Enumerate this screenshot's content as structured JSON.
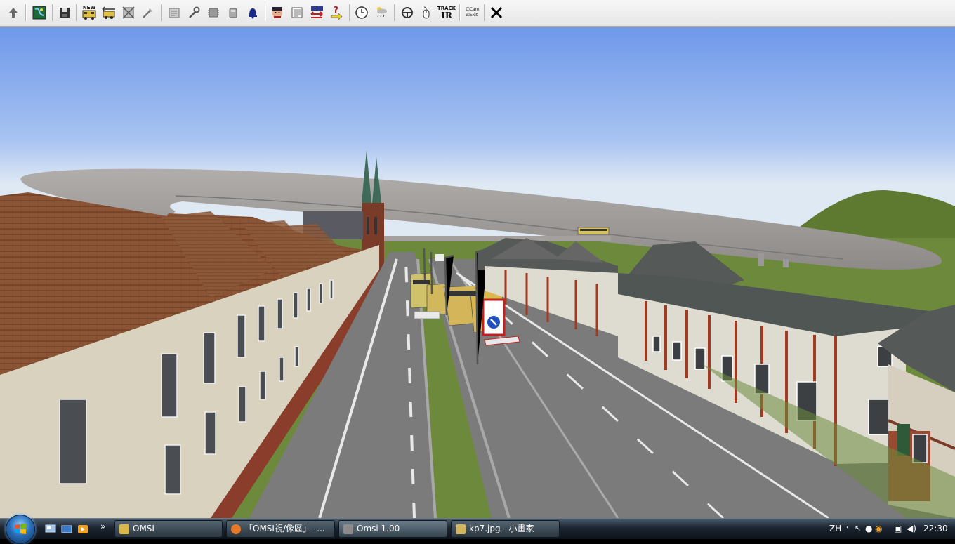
{
  "toolbar": {
    "items": [
      {
        "name": "up-arrow-icon"
      },
      {
        "name": "map-icon"
      },
      {
        "name": "save-icon"
      },
      {
        "name": "new-bus-icon",
        "label": "NEW"
      },
      {
        "name": "bus-select-icon"
      },
      {
        "name": "bus-remove-icon"
      },
      {
        "name": "bus-tools-icon"
      },
      {
        "name": "timetable-icon"
      },
      {
        "name": "wrench-icon"
      },
      {
        "name": "chip-icon"
      },
      {
        "name": "fuel-icon"
      },
      {
        "name": "bell-icon"
      },
      {
        "name": "driver-icon"
      },
      {
        "name": "ticket-icon"
      },
      {
        "name": "transfer-icon"
      },
      {
        "name": "help-arrow-icon"
      },
      {
        "name": "clock-icon"
      },
      {
        "name": "weather-icon"
      },
      {
        "name": "steering-icon"
      },
      {
        "name": "mouse-icon"
      },
      {
        "name": "trackir-icon",
        "label_top": "TRACK",
        "label_bottom": "IR"
      },
      {
        "name": "options-icon",
        "label_top": "Cam",
        "label_bottom": "Exit"
      },
      {
        "name": "close-icon"
      }
    ]
  },
  "taskbar": {
    "tasks": [
      {
        "label": "OMSI",
        "color": "#d8b84a"
      },
      {
        "label": "「OMSI視/像區」 -...",
        "color": "#e8772a"
      },
      {
        "label": "Omsi 1.00",
        "color": "#8a8a8a"
      },
      {
        "label": "kp7.jpg - 小畫家",
        "color": "#d2b560"
      }
    ],
    "tray": {
      "lang": "ZH",
      "time": "22:30"
    }
  },
  "colors": {
    "sky_top": "#6e98ea",
    "sky_bottom": "#dfe9f4",
    "road": "#7b7b7b",
    "grass": "#6d8a3c",
    "roof": "#8b5435",
    "wall": "#d9d4c4"
  }
}
